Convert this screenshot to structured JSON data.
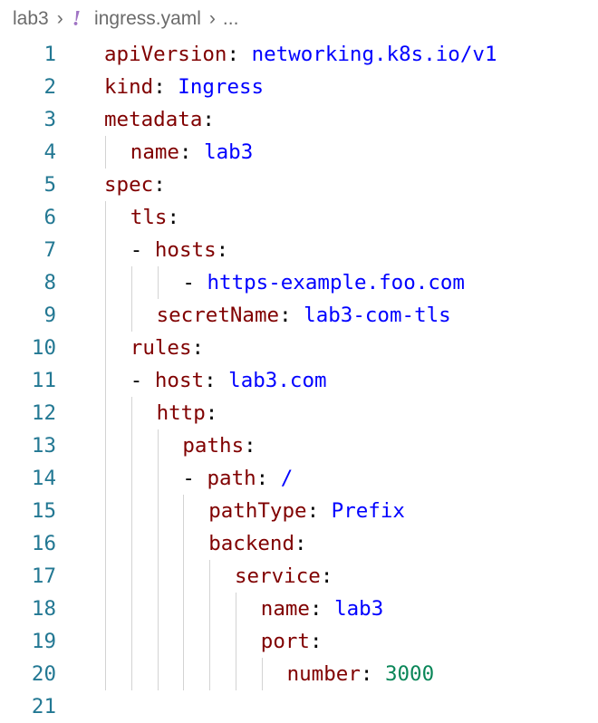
{
  "breadcrumb": {
    "folder": "lab3",
    "file": "ingress.yaml",
    "ellipsis": "...",
    "file_icon": "yaml-exclamation-icon"
  },
  "colors": {
    "line_number": "#237893",
    "key": "#800000",
    "string": "#0000ff",
    "number": "#098658",
    "indent_guide": "#d3d3d3",
    "yaml_icon": "#a074c4"
  },
  "lines": [
    {
      "num": "1",
      "indent": 0,
      "dash": false,
      "key": "apiVersion",
      "sep": ": ",
      "value": "networking.k8s.io/v1",
      "vtype": "str"
    },
    {
      "num": "2",
      "indent": 0,
      "dash": false,
      "key": "kind",
      "sep": ": ",
      "value": "Ingress",
      "vtype": "str"
    },
    {
      "num": "3",
      "indent": 0,
      "dash": false,
      "key": "metadata",
      "sep": ":",
      "value": "",
      "vtype": "str"
    },
    {
      "num": "4",
      "indent": 1,
      "dash": false,
      "key": "name",
      "sep": ": ",
      "value": "lab3",
      "vtype": "str"
    },
    {
      "num": "5",
      "indent": 0,
      "dash": false,
      "key": "spec",
      "sep": ":",
      "value": "",
      "vtype": "str"
    },
    {
      "num": "6",
      "indent": 1,
      "dash": false,
      "key": "tls",
      "sep": ":",
      "value": "",
      "vtype": "str"
    },
    {
      "num": "7",
      "indent": 1,
      "dash": true,
      "key": "hosts",
      "sep": ":",
      "value": "",
      "vtype": "str"
    },
    {
      "num": "8",
      "indent": 3,
      "dash": true,
      "key": "",
      "sep": "",
      "value": "https-example.foo.com",
      "vtype": "str"
    },
    {
      "num": "9",
      "indent": 2,
      "dash": false,
      "key": "secretName",
      "sep": ": ",
      "value": "lab3-com-tls",
      "vtype": "str"
    },
    {
      "num": "10",
      "indent": 1,
      "dash": false,
      "key": "rules",
      "sep": ":",
      "value": "",
      "vtype": "str"
    },
    {
      "num": "11",
      "indent": 1,
      "dash": true,
      "key": "host",
      "sep": ": ",
      "value": "lab3.com",
      "vtype": "str"
    },
    {
      "num": "12",
      "indent": 2,
      "dash": false,
      "key": "http",
      "sep": ":",
      "value": "",
      "vtype": "str"
    },
    {
      "num": "13",
      "indent": 3,
      "dash": false,
      "key": "paths",
      "sep": ":",
      "value": "",
      "vtype": "str"
    },
    {
      "num": "14",
      "indent": 3,
      "dash": true,
      "key": "path",
      "sep": ": ",
      "value": "/",
      "vtype": "str"
    },
    {
      "num": "15",
      "indent": 4,
      "dash": false,
      "key": "pathType",
      "sep": ": ",
      "value": "Prefix",
      "vtype": "str"
    },
    {
      "num": "16",
      "indent": 4,
      "dash": false,
      "key": "backend",
      "sep": ":",
      "value": "",
      "vtype": "str"
    },
    {
      "num": "17",
      "indent": 5,
      "dash": false,
      "key": "service",
      "sep": ":",
      "value": "",
      "vtype": "str"
    },
    {
      "num": "18",
      "indent": 6,
      "dash": false,
      "key": "name",
      "sep": ": ",
      "value": "lab3",
      "vtype": "str"
    },
    {
      "num": "19",
      "indent": 6,
      "dash": false,
      "key": "port",
      "sep": ":",
      "value": "",
      "vtype": "str"
    },
    {
      "num": "20",
      "indent": 7,
      "dash": false,
      "key": "number",
      "sep": ": ",
      "value": "3000",
      "vtype": "num"
    },
    {
      "num": "21",
      "indent": 0,
      "dash": false,
      "key": "",
      "sep": "",
      "value": "",
      "vtype": "str"
    }
  ]
}
